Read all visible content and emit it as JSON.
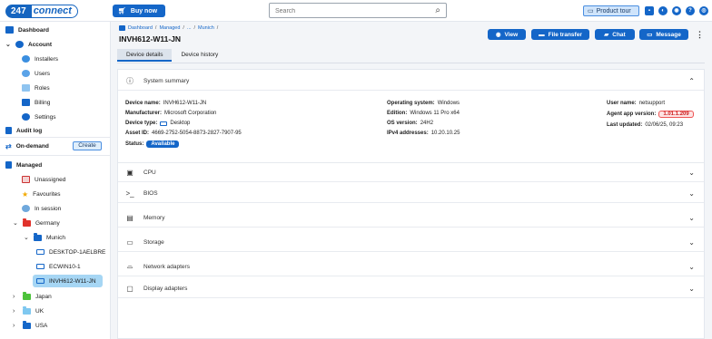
{
  "header": {
    "logo_num": "247",
    "logo_word": "connect",
    "buy_now": "Buy now",
    "search_placeholder": "Search",
    "product_tour": "Product tour"
  },
  "sidebar": {
    "dashboard": "Dashboard",
    "account": "Account",
    "installers": "Installers",
    "users": "Users",
    "roles": "Roles",
    "billing": "Billing",
    "settings": "Settings",
    "audit_log": "Audit log",
    "on_demand": "On-demand",
    "create": "Create",
    "managed": "Managed",
    "unassigned": "Unassigned",
    "favourites": "Favourites",
    "in_session": "In session",
    "germany": "Germany",
    "munich": "Munich",
    "devices": [
      "DESKTOP-1AELBRE",
      "ECWIN10-1",
      "INVH612-W11-JN"
    ],
    "japan": "Japan",
    "uk": "UK",
    "usa": "USA"
  },
  "breadcrumb": [
    "Dashboard",
    "Managed",
    "...",
    "Munich"
  ],
  "page_title": "INVH612-W11-JN",
  "actions": {
    "view": "View",
    "file_transfer": "File transfer",
    "chat": "Chat",
    "message": "Message"
  },
  "tabs": [
    "Device details",
    "Device history"
  ],
  "summary": {
    "title": "System summary",
    "device_name_label": "Device name:",
    "device_name": "INVH612-W11-JN",
    "manufacturer_label": "Manufacturer:",
    "manufacturer": "Microsoft Corporation",
    "device_type_label": "Device type:",
    "device_type": "Desktop",
    "asset_id_label": "Asset ID:",
    "asset_id": "4669-2752-5054-8873-2827-7907-95",
    "status_label": "Status:",
    "status": "Available",
    "os_label": "Operating system:",
    "os": "Windows",
    "edition_label": "Edition:",
    "edition": "Windows 11 Pro x64",
    "os_version_label": "OS version:",
    "os_version": "24H2",
    "ipv4_label": "IPv4 addresses:",
    "ipv4": "10.20.10.25",
    "user_label": "User name:",
    "user": "netsupport",
    "agent_label": "Agent app version:",
    "agent": "1.01.1.209",
    "updated_label": "Last updated:",
    "updated": "02/06/25, 09:23"
  },
  "sections": [
    "CPU",
    "BIOS",
    "Memory",
    "Storage",
    "Network adapters",
    "Display adapters"
  ],
  "colors": {
    "accent": "#1466c8",
    "selected": "#a6d6f4",
    "warning": "#c22"
  }
}
